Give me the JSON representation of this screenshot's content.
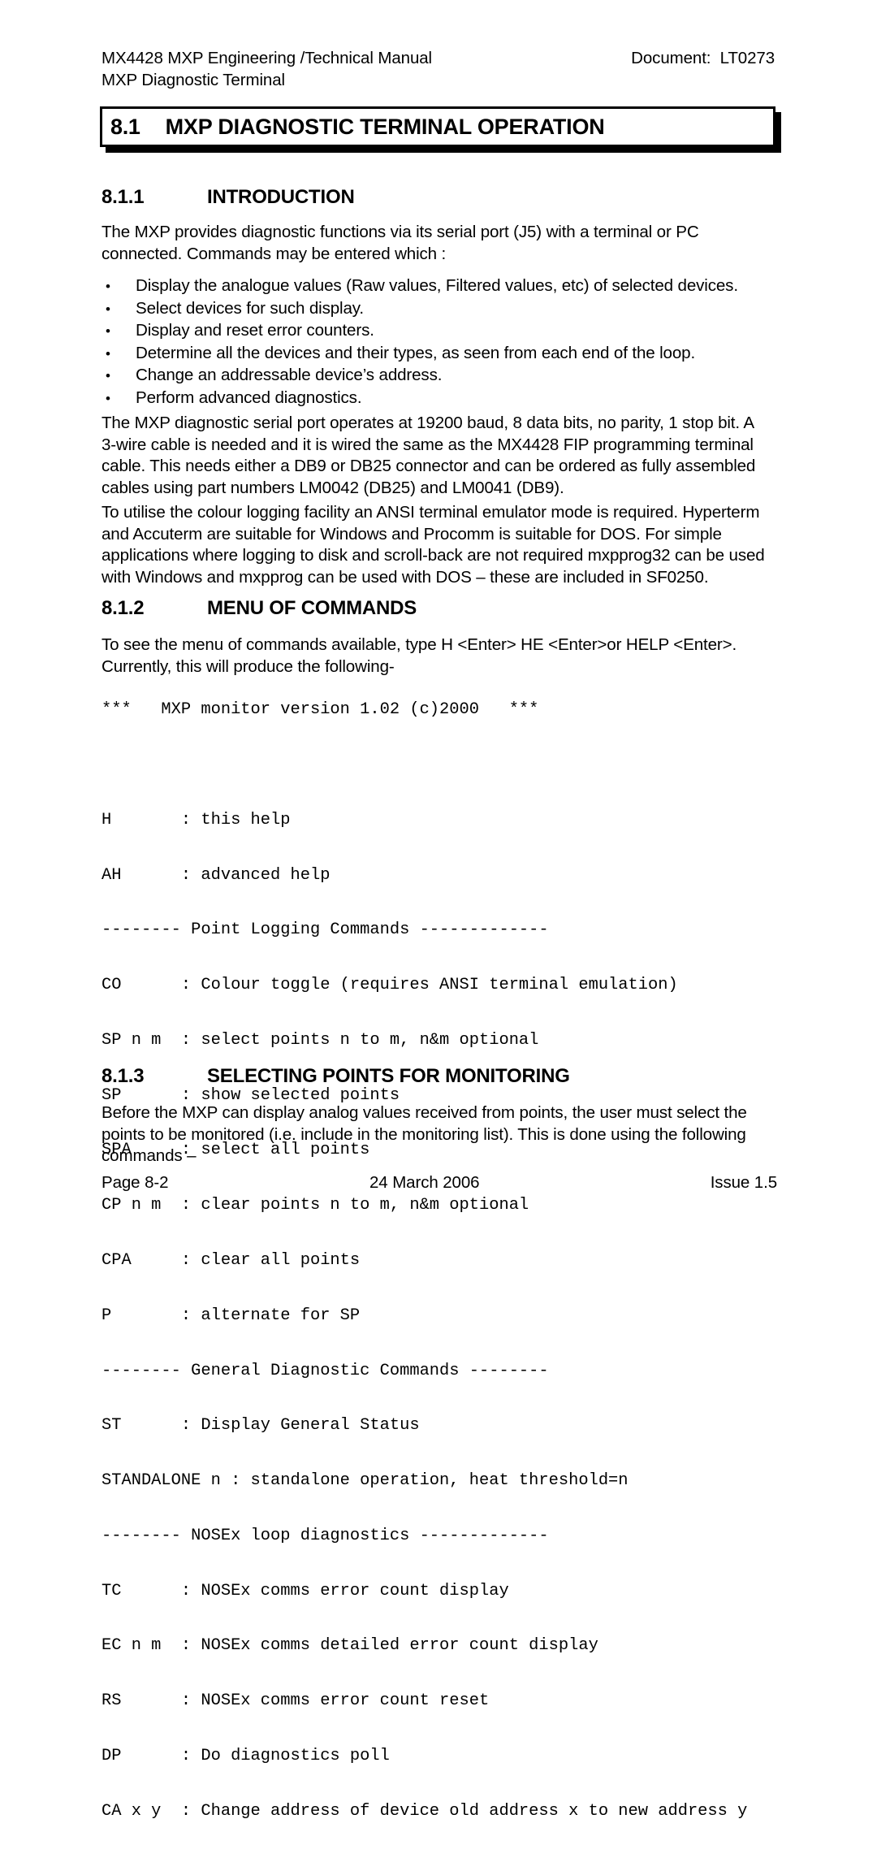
{
  "header": {
    "left_line1": "MX4428 MXP Engineering /Technical Manual",
    "left_line2": "MXP Diagnostic Terminal",
    "right": "Document:  LT0273"
  },
  "banner": {
    "number": "8.1",
    "title": "MXP DIAGNOSTIC TERMINAL OPERATION"
  },
  "sections": {
    "introduction": {
      "number": "8.1.1",
      "title": "INTRODUCTION",
      "paragraph": "The MXP provides diagnostic functions via its serial port (J5) with a terminal or PC connected. Commands may be entered which :",
      "bullets": [
        "Display the analogue values (Raw values, Filtered values, etc) of selected devices.",
        "Select devices for such display.",
        "Display and reset error counters.",
        "Determine all the devices and their types, as seen from each end of the loop.",
        "Change an addressable device’s address.",
        "Perform advanced diagnostics."
      ],
      "bullet_glyph": "•",
      "paragraph2": "The MXP diagnostic serial port operates at 19200 baud, 8 data bits, no parity, 1 stop bit. A 3-wire cable is needed and it is wired the same as the MX4428 FIP programming terminal cable.  This needs either a DB9 or DB25 connector and can be ordered as fully assembled cables using part numbers LM0042 (DB25) and LM0041 (DB9).",
      "paragraph3": "To utilise the colour logging facility an ANSI terminal emulator mode is required.  Hyperterm and Accuterm are suitable for Windows and Procomm is suitable for DOS. For simple applications where logging to disk and scroll-back are not required mxpprog32 can be used with Windows and mxpprog can be used with DOS – these are included in SF0250."
    },
    "menu_of_commands": {
      "number": "8.1.2",
      "title": "MENU OF COMMANDS",
      "paragraph": "To see the menu of commands available, type H <Enter> HE <Enter>or HELP <Enter>. Currently, this will produce the following-",
      "terminal_lines": [
        "***   MXP monitor version 1.02 (c)2000   ***",
        "",
        "H       : this help",
        "AH      : advanced help",
        "-------- Point Logging Commands -------------",
        "CO      : Colour toggle (requires ANSI terminal emulation)",
        "SP n m  : select points n to m, n&m optional",
        "SP      : show selected points",
        "SPA     : select all points",
        "CP n m  : clear points n to m, n&m optional",
        "CPA     : clear all points",
        "P       : alternate for SP",
        "-------- General Diagnostic Commands --------",
        "ST      : Display General Status",
        "STANDALONE n : standalone operation, heat threshold=n",
        "-------- NOSEx loop diagnostics -------------",
        "TC      : NOSEx comms error count display",
        "EC n m  : NOSEx comms detailed error count display",
        "RS      : NOSEx comms error count reset",
        "DP      : Do diagnostics poll",
        "CA x y  : Change address of device old address x to new address y"
      ]
    },
    "selecting_points": {
      "number": "8.1.3",
      "title": "SELECTING POINTS FOR MONITORING",
      "paragraph": "Before the MXP can display analog values received from points, the user must select the points to be monitored (i.e. include in the monitoring list). This is done using the following commands –"
    }
  },
  "footer": {
    "page": "Page 8-2",
    "date": "24 March 2006",
    "issue": "Issue 1.5"
  }
}
